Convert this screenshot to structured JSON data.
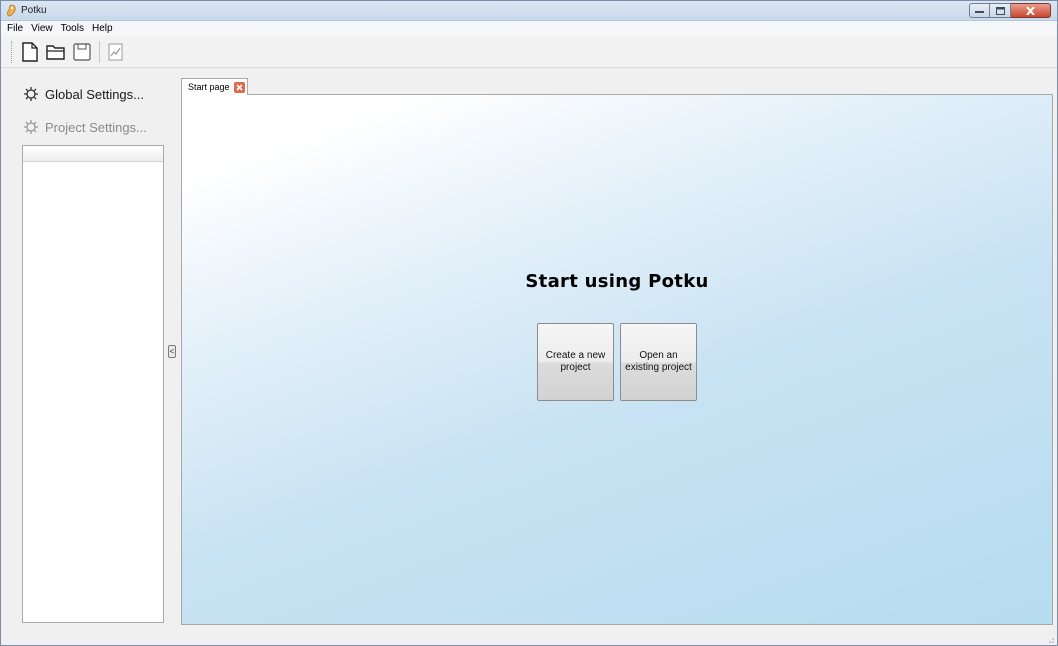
{
  "window": {
    "title": "Potku",
    "controls": [
      "minimize-icon",
      "maximize-icon",
      "close-icon"
    ]
  },
  "menu": {
    "items": [
      "File",
      "View",
      "Tools",
      "Help"
    ]
  },
  "toolbar": {
    "buttons": [
      "new-document-icon",
      "open-folder-icon",
      "save-icon",
      "chart-icon"
    ]
  },
  "left_panel": {
    "global_settings_label": "Global Settings...",
    "project_settings_label": "Project Settings...",
    "collapse_label": "<"
  },
  "tabs": [
    {
      "label": "Start page",
      "closable": true
    }
  ],
  "start_page": {
    "title": "Start using Potku",
    "create_button_label": "Create a new project",
    "open_button_label": "Open an existing project"
  },
  "colors": {
    "content_gradient_end": "#b6dcf0",
    "tab_close": "#e06a48",
    "window_close": "#c9472f"
  }
}
